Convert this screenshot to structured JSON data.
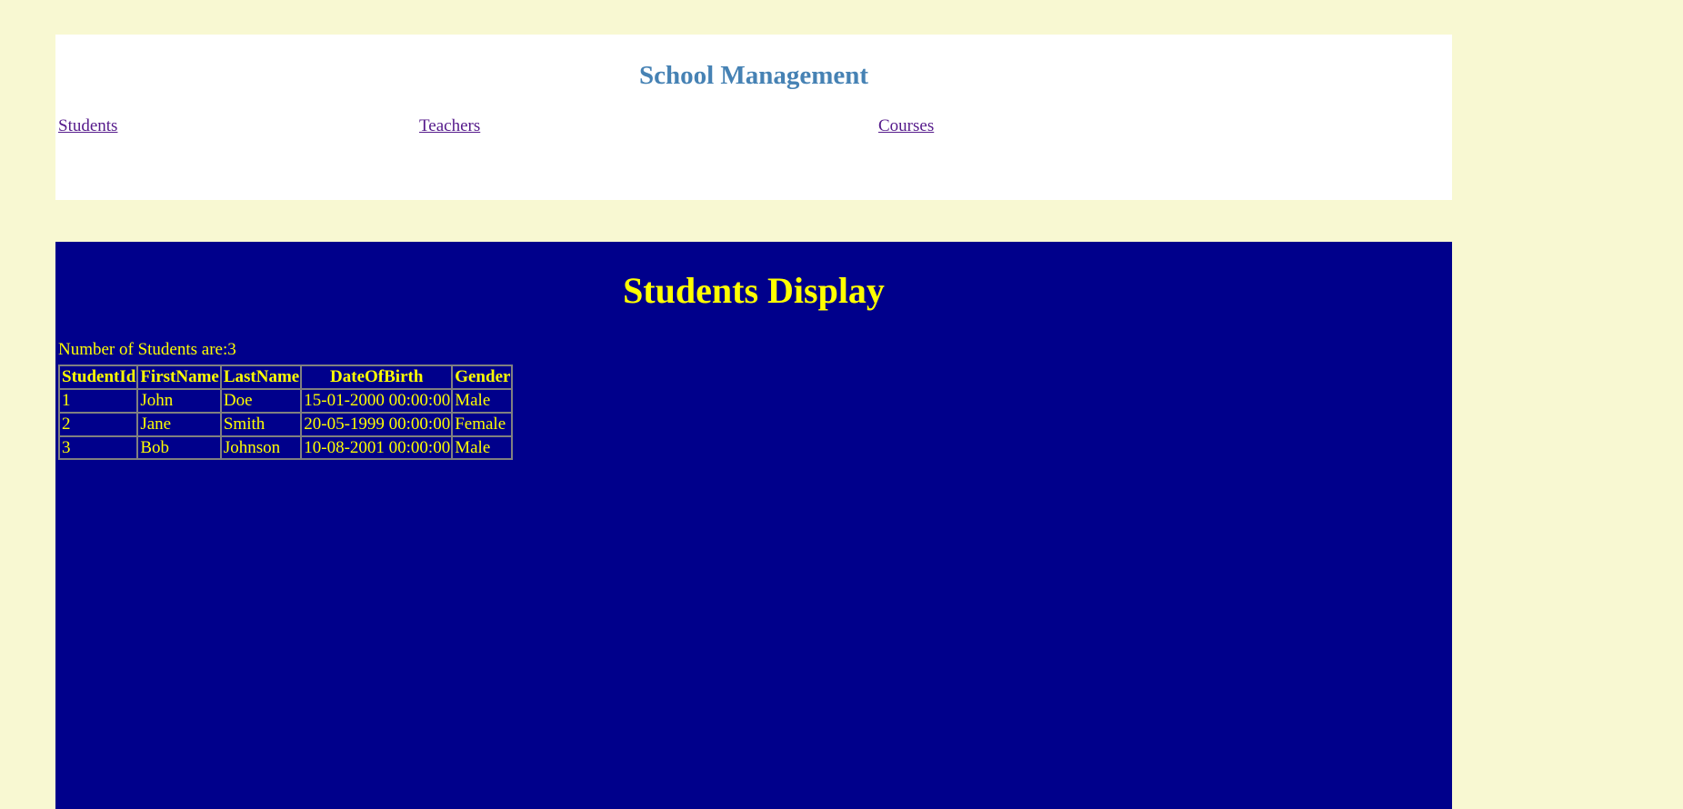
{
  "header": {
    "title": "School Management",
    "nav": {
      "students": "Students",
      "teachers": "Teachers",
      "courses": "Courses"
    }
  },
  "main": {
    "heading": "Students Display",
    "count_text": "Number of Students are:3",
    "table": {
      "columns": [
        "StudentId",
        "FirstName",
        "LastName",
        "DateOfBirth",
        "Gender"
      ],
      "rows": [
        [
          "1",
          "John",
          "Doe",
          "15-01-2000 00:00:00",
          "Male"
        ],
        [
          "2",
          "Jane",
          "Smith",
          "20-05-1999 00:00:00",
          "Female"
        ],
        [
          "3",
          "Bob",
          "Johnson",
          "10-08-2001 00:00:00",
          "Male"
        ]
      ]
    }
  },
  "colors": {
    "page_background": "#f8f8d2",
    "header_background": "#ffffff",
    "title": "#4682b4",
    "link": "#551a8b",
    "main_background": "#00008b",
    "main_text": "#ffff00"
  }
}
